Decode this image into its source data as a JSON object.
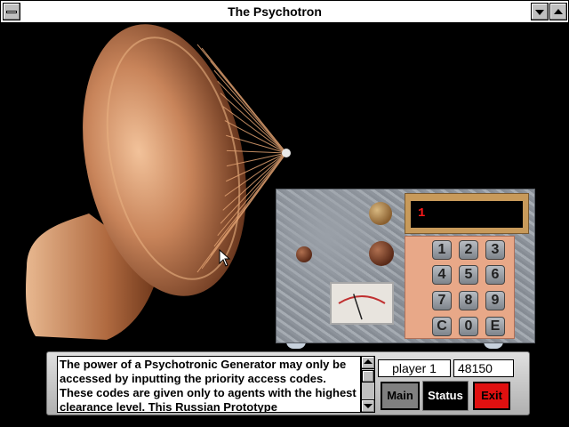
{
  "window": {
    "title": "The Psychotron"
  },
  "machine": {
    "display_value": "1",
    "keypad": [
      "1",
      "2",
      "3",
      "4",
      "5",
      "6",
      "7",
      "8",
      "9",
      "C",
      "0",
      "E"
    ],
    "meter_value": 0.35
  },
  "info_panel": {
    "description": "The power of a Psychotronic Generator may only be accessed by inputting the priority access codes. These codes are given only to agents with the highest clearance level. This Russian Prototype"
  },
  "hud": {
    "player_label": "player 1",
    "score": "48150",
    "main_label": "Main",
    "status_label": "Status",
    "exit_label": "Exit"
  },
  "colors": {
    "display_text": "#ff1a1a",
    "exit_button": "#e01010",
    "status_button": "#000000",
    "main_button": "#808080",
    "keypad_panel": "#e8a888",
    "horn_copper": "#c8845a"
  }
}
